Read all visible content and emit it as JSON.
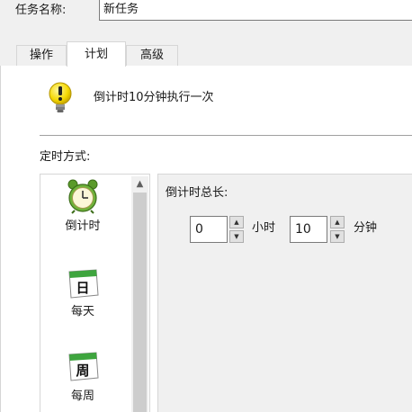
{
  "task": {
    "name_label": "任务名称:",
    "name_value": "新任务"
  },
  "tabs": [
    {
      "label": "操作",
      "selected": false
    },
    {
      "label": "计划",
      "selected": true
    },
    {
      "label": "高级",
      "selected": false
    }
  ],
  "hint": {
    "icon": "warning-icon",
    "text": "倒计时10分钟执行一次"
  },
  "schedule": {
    "mode_label": "定时方式:",
    "modes": [
      {
        "label": "倒计时",
        "icon": "alarm-clock-icon",
        "selected": true
      },
      {
        "label": "每天",
        "icon": "calendar-day-icon",
        "icon_text": "日",
        "selected": false
      },
      {
        "label": "每周",
        "icon": "calendar-week-icon",
        "icon_text": "周",
        "selected": false
      }
    ],
    "duration_label": "倒计时总长:",
    "hours_value": "0",
    "hours_unit": "小时",
    "minutes_value": "10",
    "minutes_unit": "分钟"
  },
  "colors": {
    "window_bg": "#f0f0f0",
    "panel_bg": "#ffffff",
    "border": "#d6d6d6",
    "warning_yellow": "#f5d800",
    "calendar_green": "#3ea53e"
  }
}
